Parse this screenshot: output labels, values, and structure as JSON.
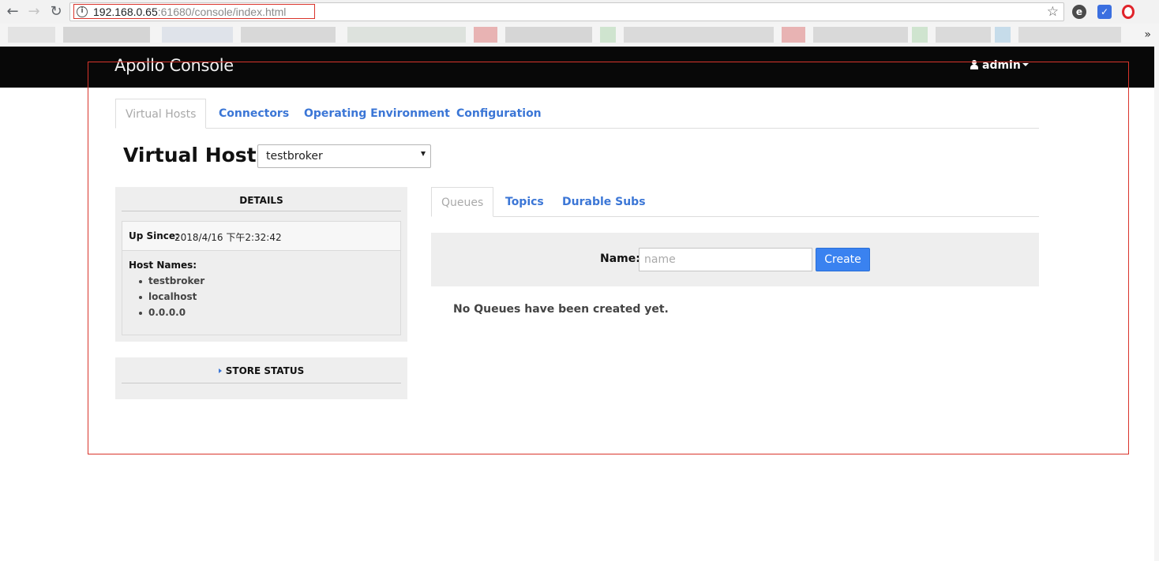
{
  "browser": {
    "url_host": "192.168.0.65",
    "url_path": ":61680/console/index.html",
    "back_icon": "back-arrow-icon",
    "forward_icon": "forward-arrow-icon",
    "reload_icon": "reload-icon",
    "info_icon": "info-icon",
    "star_icon": "star-icon",
    "bookmarks_more": "»"
  },
  "navbar": {
    "brand": "Apollo Console",
    "user_label": "admin"
  },
  "top_tabs": [
    {
      "label": "Virtual Hosts",
      "active": true
    },
    {
      "label": "Connectors",
      "active": false
    },
    {
      "label": "Operating Environment",
      "active": false
    },
    {
      "label": "Configuration",
      "active": false
    }
  ],
  "virtual_host": {
    "label": "Virtual Host:",
    "selected": "testbroker"
  },
  "details": {
    "heading": "DETAILS",
    "up_since_label": "Up Since:",
    "up_since_value": "2018/4/16 下午2:32:42",
    "host_names_label": "Host Names:",
    "host_names": [
      "testbroker",
      "localhost",
      "0.0.0.0"
    ]
  },
  "store_status": {
    "heading": "STORE STATUS"
  },
  "inner_tabs": [
    {
      "label": "Queues",
      "active": true
    },
    {
      "label": "Topics",
      "active": false
    },
    {
      "label": "Durable Subs",
      "active": false
    }
  ],
  "create_form": {
    "name_label": "Name:",
    "name_placeholder": "name",
    "create_label": "Create"
  },
  "empty_message": "No Queues have been created yet.",
  "colors": {
    "navbar_bg": "#080808",
    "link": "#3b76d6",
    "button": "#3a82f0",
    "annotation": "#d9342b"
  }
}
